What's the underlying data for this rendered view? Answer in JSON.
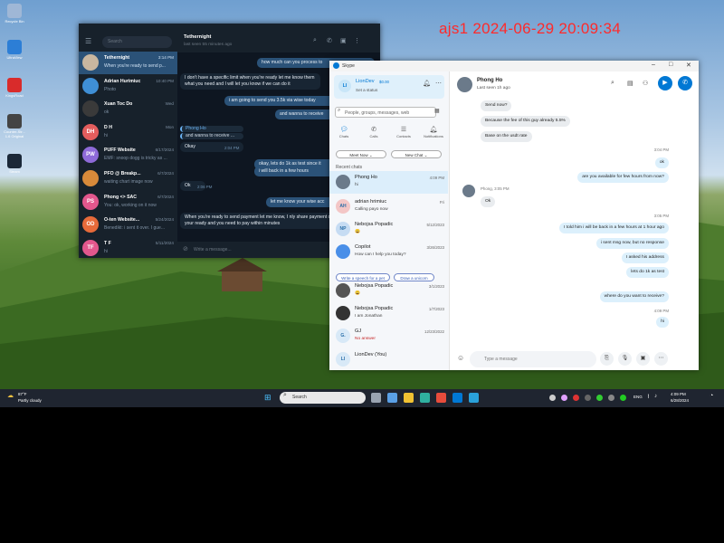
{
  "watermark": "ajs1 2024-06-29 20:09:34",
  "desktop": {
    "icons": [
      {
        "label": "Recycle Bin",
        "color": "#9fb7d6"
      },
      {
        "label": "UltraView",
        "color": "#2c7ed6"
      },
      {
        "label": "KingsRoad",
        "color": "#d92b2b"
      },
      {
        "label": "Counter-Str... 1.6 Original",
        "color": "#444444"
      },
      {
        "label": "Steam",
        "color": "#1b2838"
      }
    ]
  },
  "telegram": {
    "search_placeholder": "Search",
    "header": {
      "title": "Tethernight",
      "status": "last seen 55 minutes ago"
    },
    "chats": [
      {
        "name": "Tethernight",
        "time": "3:14 PM",
        "msg": "When you're ready to send p...",
        "avatar_text": "",
        "color": "#c9b7a0",
        "active": true
      },
      {
        "name": "Adrian Hurimiuc",
        "time": "10:40 PM",
        "msg": "Photo",
        "avatar_text": "",
        "color": "#3f8fd6",
        "active": false
      },
      {
        "name": "Xuan Toc Do",
        "time": "Wed",
        "msg": "ok",
        "avatar_text": "",
        "color": "#3a3a3a",
        "active": false
      },
      {
        "name": "D H",
        "time": "Mon",
        "msg": "hi",
        "avatar_text": "DH",
        "color": "#e35d5d",
        "active": false
      },
      {
        "name": "PUFF Website",
        "time": "6/17/2024",
        "msg": "EMF: snoop dogg is tricky as ...",
        "avatar_text": "PW",
        "color": "#8e6ad8",
        "active": false
      },
      {
        "name": "PFO @ Breakp...",
        "time": "6/7/2024",
        "msg": "waiting chart image now",
        "avatar_text": "",
        "color": "#d88a3a",
        "active": false
      },
      {
        "name": "Phong <> SAC",
        "time": "6/7/2024",
        "msg": "You: ok, working on it now",
        "avatar_text": "PS",
        "color": "#e2578d",
        "active": false
      },
      {
        "name": "O-ten Website...",
        "time": "5/24/2024",
        "msg": "Benedikt: i sent it over. I gue...",
        "avatar_text": "OD",
        "color": "#e76a3a",
        "active": false
      },
      {
        "name": "T F",
        "time": "5/11/2024",
        "msg": "hi",
        "avatar_text": "TF",
        "color": "#e2578d",
        "active": false
      }
    ],
    "messages": [
      {
        "text": "how much can you process to",
        "dir": "out"
      },
      {
        "text": "I don't have a specific limit when you're ready let me know them what you need and I will let you know if we can do it",
        "dir": "in"
      },
      {
        "text": "i am going to send you 3.5k via wise today",
        "dir": "out"
      },
      {
        "text": "and wanna to receive",
        "dir": "out"
      },
      {
        "text": "Phong Ho",
        "dir": "reply"
      },
      {
        "text": "and wanna to receive ...",
        "dir": "reply"
      },
      {
        "text": "Okay",
        "dir": "in"
      },
      {
        "text": "2:04 PM",
        "dir": "time"
      },
      {
        "text": "okay, lets do 1k as test since it",
        "dir": "out"
      },
      {
        "text": "i will back in a few hours",
        "dir": "out"
      },
      {
        "text": "Ok",
        "dir": "in"
      },
      {
        "text": "2:06 PM",
        "dir": "time"
      },
      {
        "text": "let me know your wise acc",
        "dir": "out"
      },
      {
        "text": "When you're ready to send payment let me know, I nly share payment details when your ready and you need to pay within minutes",
        "dir": "in"
      }
    ],
    "input_placeholder": "Write a message..."
  },
  "skype": {
    "title": "Skype",
    "profile": {
      "name": "LionDev",
      "balance": "$0.00",
      "status": "Set a status",
      "initials": "LI"
    },
    "search_placeholder": "People, groups, messages, web",
    "nav": [
      {
        "label": "Chats",
        "icon": "chat-icon"
      },
      {
        "label": "Calls",
        "icon": "phone-icon"
      },
      {
        "label": "Contacts",
        "icon": "contacts-icon"
      },
      {
        "label": "Notifications",
        "icon": "bell-icon"
      }
    ],
    "meet_now": "Meet Now",
    "new_chat": "New Chat",
    "recent_label": "Recent chats",
    "chats": [
      {
        "name": "Phong Ho",
        "time": "4:09 PM",
        "msg": "hi",
        "initials": "",
        "color": "#6b7a8a",
        "active": true
      },
      {
        "name": "adrian hrimiuc",
        "time": "Fri",
        "msg": "Calling payo now",
        "initials": "AH",
        "color": "#f3c6c6",
        "active": false
      },
      {
        "name": "Nebojsa Popadic",
        "time": "5/12/2023",
        "msg": "😀",
        "initials": "NP",
        "color": "#c6dcf3",
        "active": false
      },
      {
        "name": "Copilot",
        "time": "3/26/2023",
        "msg": "How can I help you today?",
        "initials": "",
        "color": "#4a8fe8",
        "active": false
      },
      {
        "name": "Nebojsa Popadic",
        "time": "3/1/2023",
        "msg": "😀",
        "initials": "",
        "color": "#555",
        "active": false
      },
      {
        "name": "Nebojsa Popadic",
        "time": "1/7/2023",
        "msg": "I am Jonathan",
        "initials": "",
        "color": "#333",
        "active": false
      },
      {
        "name": "GJ",
        "time": "12/23/2022",
        "msg": "No answer",
        "initials": "G.",
        "color": "#d8e9f7",
        "active": false
      },
      {
        "name": "LionDev (You)",
        "time": "",
        "msg": "",
        "initials": "LI",
        "color": "#d8e9f7",
        "active": false
      }
    ],
    "copilot_prompts": [
      "Write a speech for a pet",
      "Draw a unicorn"
    ],
    "contact": {
      "name": "Phong Ho",
      "status": "Last seen 1h ago"
    },
    "messages": [
      {
        "text": "Send now?",
        "side": "them"
      },
      {
        "text": "Because the fee of this guy already 5.5%",
        "side": "them"
      },
      {
        "text": "Base on the usdt rate",
        "side": "them"
      },
      {
        "text": "3:04 PM",
        "side": "time-me"
      },
      {
        "text": "ok",
        "side": "me"
      },
      {
        "text": "are you available for few hours from now?",
        "side": "me"
      },
      {
        "text": "Phong, 3:05 PM",
        "side": "time-them"
      },
      {
        "text": "Ok",
        "side": "them"
      },
      {
        "text": "3:05 PM",
        "side": "time-me"
      },
      {
        "text": "I told him i will be back in a few hours at 1 hour ago",
        "side": "me"
      },
      {
        "text": "i sent msg now, but no response",
        "side": "me"
      },
      {
        "text": "I asked his address",
        "side": "me"
      },
      {
        "text": "lets do 1k as test",
        "side": "me"
      },
      {
        "text": "where do you want to receive?",
        "side": "me"
      },
      {
        "text": "4:09 PM",
        "side": "time-me"
      },
      {
        "text": "hi",
        "side": "me"
      }
    ],
    "input_placeholder": "Type a message"
  },
  "taskbar": {
    "weather_temp": "87°F",
    "weather_desc": "Partly cloudy",
    "search": "Search",
    "lang": "ENG",
    "time": "4:09 PM",
    "date": "6/28/2024"
  }
}
